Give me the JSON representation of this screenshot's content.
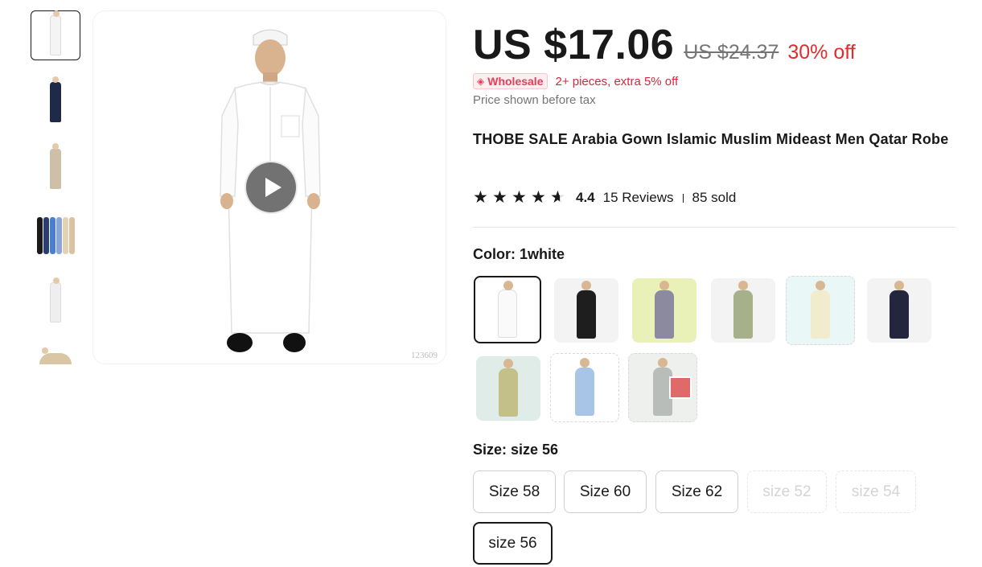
{
  "gallery": {
    "thumbnails": [
      {
        "name": "thumb-white-robe",
        "color": "#f4f4f4"
      },
      {
        "name": "thumb-navy-robe",
        "color": "#1f2a4a"
      },
      {
        "name": "thumb-beige-robe",
        "color": "#cdbfa8"
      },
      {
        "name": "thumb-multi-color-robes",
        "color": "#4a6fb3"
      },
      {
        "name": "thumb-white-robe-side",
        "color": "#eeeeee"
      },
      {
        "name": "thumb-beige-robe-closeup",
        "color": "#d9c6a5"
      }
    ],
    "watermark": "123609"
  },
  "price": {
    "current": "US $17.06",
    "original": "US $24.37",
    "discount": "30% off"
  },
  "wholesale": {
    "icon": "tag-icon",
    "badge": "Wholesale",
    "text": "2+ pieces, extra 5% off"
  },
  "tax_note": "Price shown before tax",
  "product": {
    "title": "THOBE SALE Arabia Gown Islamic Muslim Mideast Men Qatar Robe"
  },
  "rating": {
    "score": "4.4",
    "stars_value": 4.4,
    "reviews": "15 Reviews",
    "sold": "85 sold"
  },
  "color": {
    "label": "Color: 1white",
    "options": [
      {
        "name": "white",
        "robe": "#fafafa",
        "bg": "#ffffff"
      },
      {
        "name": "black",
        "robe": "#1e1e1e",
        "bg": "#f3f3f3"
      },
      {
        "name": "grey-purple",
        "robe": "#8b8a9e",
        "bg": "#e9f0b8"
      },
      {
        "name": "sage",
        "robe": "#a6b08a",
        "bg": "#f3f3f3"
      },
      {
        "name": "cream",
        "robe": "#f1eccd",
        "bg": "#eaf7f7"
      },
      {
        "name": "navy",
        "robe": "#23263d",
        "bg": "#f3f3f3"
      },
      {
        "name": "olive",
        "robe": "#c4c08a",
        "bg": "#dfece8"
      },
      {
        "name": "light-blue",
        "robe": "#a8c4e6",
        "bg": "#ffffff"
      },
      {
        "name": "grey",
        "robe": "#b9bdb9",
        "bg": "#eef0ee"
      }
    ]
  },
  "size": {
    "label": "Size: size 56",
    "options": [
      {
        "label": "Size 58",
        "state": "available"
      },
      {
        "label": "Size 60",
        "state": "available"
      },
      {
        "label": "Size 62",
        "state": "available"
      },
      {
        "label": "size 52",
        "state": "disabled"
      },
      {
        "label": "size 54",
        "state": "disabled"
      },
      {
        "label": "size 56",
        "state": "selected"
      }
    ]
  }
}
